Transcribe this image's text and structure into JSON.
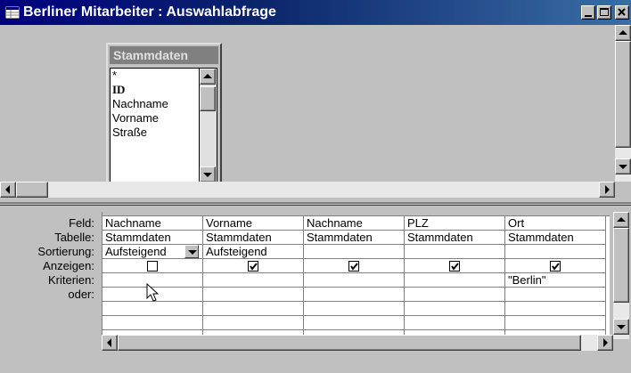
{
  "window": {
    "title": "Berliner Mitarbeiter : Auswahlabfrage"
  },
  "tablebox": {
    "title": "Stammdaten",
    "fields": [
      "*",
      "ID",
      "Nachname",
      "Vorname",
      "Straße"
    ]
  },
  "grid": {
    "row_labels": [
      "Feld:",
      "Tabelle:",
      "Sortierung:",
      "Anzeigen:",
      "Kriterien:",
      "oder:"
    ],
    "columns": [
      {
        "feld": "Nachname",
        "tabelle": "Stammdaten",
        "sortierung": "Aufsteigend",
        "anzeigen": false,
        "kriterien": ""
      },
      {
        "feld": "Vorname",
        "tabelle": "Stammdaten",
        "sortierung": "Aufsteigend",
        "anzeigen": true,
        "kriterien": ""
      },
      {
        "feld": "Nachname",
        "tabelle": "Stammdaten",
        "sortierung": "",
        "anzeigen": true,
        "kriterien": ""
      },
      {
        "feld": "PLZ",
        "tabelle": "Stammdaten",
        "sortierung": "",
        "anzeigen": true,
        "kriterien": ""
      },
      {
        "feld": "Ort",
        "tabelle": "Stammdaten",
        "sortierung": "",
        "anzeigen": true,
        "kriterien": "\"Berlin\""
      }
    ]
  },
  "icons": {
    "title_icon": "query-icon",
    "minimize": "minimize-icon",
    "maximize": "maximize-icon",
    "close": "close-icon",
    "cursor": "arrow-cursor-icon"
  },
  "colors": {
    "titlebar": "#00007f",
    "face": "#c0c0c0",
    "table_header": "#808080"
  }
}
